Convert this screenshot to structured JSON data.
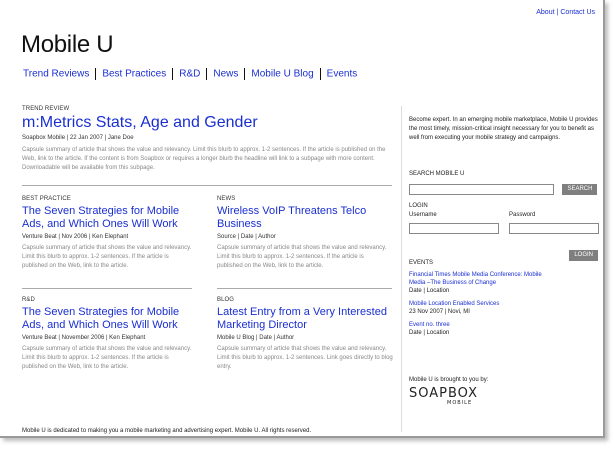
{
  "toplinks": {
    "about": "About",
    "separator": "|",
    "contact": "Contact Us"
  },
  "site": {
    "logo": "Mobile U"
  },
  "nav": {
    "items": [
      "Trend Reviews",
      "Best Practices",
      "R&D",
      "News",
      "Mobile U Blog",
      "Events"
    ]
  },
  "lead": {
    "kicker": "TREND REVIEW",
    "title": "m:Metrics Stats, Age and Gender",
    "byline": "Soapbox Mobile | 22 Jan 2007 | Jane Doe",
    "summary": "Capsule summary of article that shows the value and relevancy. Limit this blurb to approx. 1-2 sentences. If the article is published on the Web, link to the article. If the content is from Soapbox  or requires a longer blurb the headline will link to a subpage with more content. Downloadable will be available from this subpage."
  },
  "cards": [
    {
      "kicker": "BEST PRACTICE",
      "title": "The Seven Strategies for Mobile Ads, and Which Ones Will Work",
      "byline": "Venture Beat | Nov 2006 | Ken Elephant",
      "summary": "Capsule summary of article that shows the value and relevancy. Limit this blurb to approx. 1-2 sentences. If the article is published on the Web, link to the article."
    },
    {
      "kicker": "NEWS",
      "title": "Wireless VoIP Threatens Telco Business",
      "byline": "Source | Date | Author",
      "summary": "Capsule summary of article that shows the value and relevancy. Limit this blurb to approx. 1-2 sentences. If the article is published on the Web, link to the article."
    },
    {
      "kicker": "R&D",
      "title": "The Seven Strategies for Mobile Ads, and Which Ones Will Work",
      "byline": "Venture Beat | November 2006 | Ken Elephant",
      "summary": "Capsule summary of article that shows the value and relevancy. Limit this blurb to approx. 1-2 sentences. If the article is published on the Web, link to the article."
    },
    {
      "kicker": "BLOG",
      "title": "Latest Entry from a Very Interested Marketing Director",
      "byline": "Mobile U Blog | Date | Author",
      "summary": "Capsule summary of article that shows the value and relevancy. Limit this blurb to approx. 1-2 sentences. Link goes directly to blog entry."
    }
  ],
  "sidebar": {
    "intro": "Become expert. In an emerging mobile marketplace, Mobile U provides the most timely, mission-critical insight necessary for you to benefit as well from executing your mobile strategy and campaigns.",
    "search_label": "SEARCH MOBILE U",
    "search_button": "SEARCH",
    "login_label": "LOGIN",
    "username_label": "Username",
    "password_label": "Password",
    "login_button": "LOGIN",
    "events_label": "EVENTS",
    "events": [
      {
        "title": "Financial Times Mobile Media Conference: Mobile Media –The Business of Change",
        "meta": "Date | Location"
      },
      {
        "title": "Mobile Location Enabled Services",
        "meta": "23 Nov 2007  | Novi, MI"
      },
      {
        "title": "Event no. three",
        "meta": "Date | Location"
      }
    ],
    "sponsor_label": "Mobile U is brought to you by:",
    "sponsor_name": "SOAPBOX",
    "sponsor_sub": "MOBILE"
  },
  "footer": {
    "text": "Mobile U is dedicated to making you a mobile marketing and advertising expert. Mobile U. All rights reserved."
  }
}
